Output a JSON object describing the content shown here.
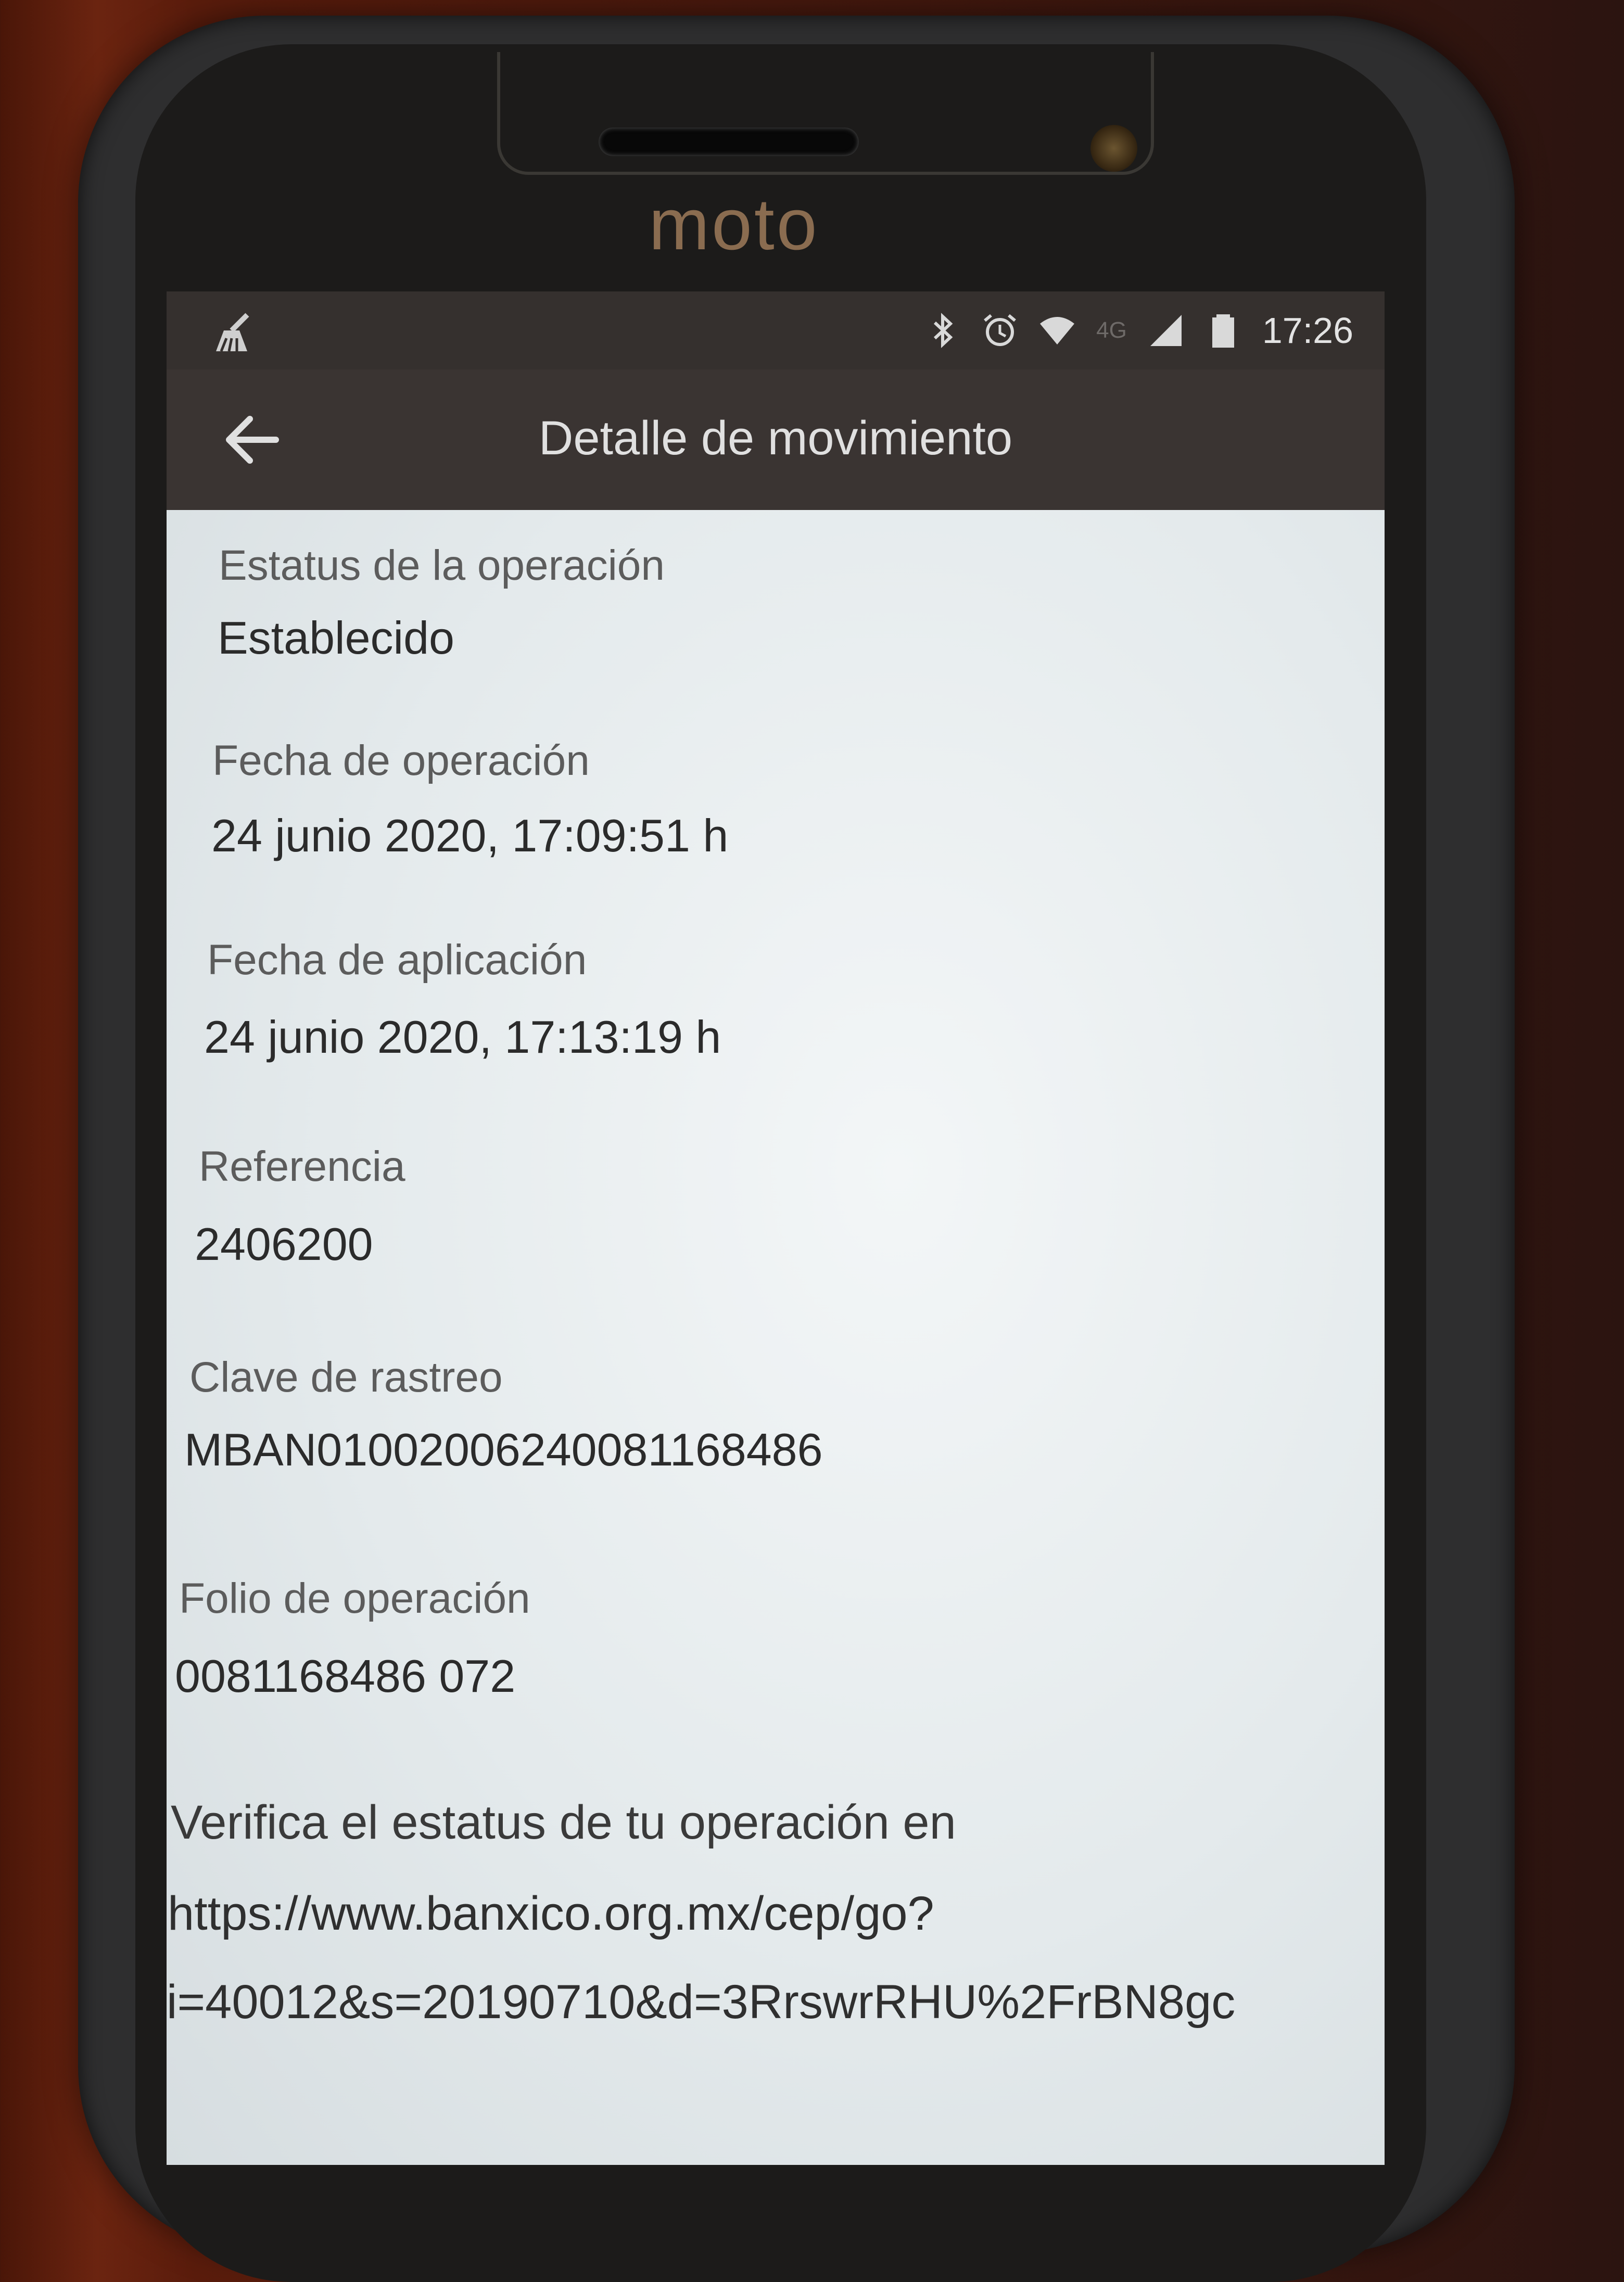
{
  "device": {
    "brand": "moto"
  },
  "status_bar": {
    "time": "17:26",
    "network": "4G",
    "icons": [
      "cleaner-icon",
      "bluetooth-icon",
      "alarm-icon",
      "wifi-icon",
      "signal-icon",
      "battery-icon"
    ]
  },
  "app_bar": {
    "title": "Detalle de movimiento",
    "back_icon": "arrow-left-icon"
  },
  "details": [
    {
      "label": "Estatus de la operación",
      "value": "Establecido"
    },
    {
      "label": "Fecha de operación",
      "value": "24 junio 2020, 17:09:51 h"
    },
    {
      "label": "Fecha de aplicación",
      "value": "24 junio 2020, 17:13:19 h"
    },
    {
      "label": "Referencia",
      "value": "2406200"
    },
    {
      "label": "Clave de rastreo",
      "value": "MBAN01002006240081168486"
    },
    {
      "label": "Folio de operación",
      "value": "0081168486 072"
    }
  ],
  "verify": {
    "text": "Verifica el estatus de tu operación en",
    "link_line1": "https://www.banxico.org.mx/cep/go?",
    "link_line2": "i=40012&s=20190710&d=3RrswrRHU%2FrBN8gc"
  },
  "colors": {
    "header_bg": "#3a3432",
    "status_bg": "#35302e",
    "content_bg": "#e6ebee"
  }
}
